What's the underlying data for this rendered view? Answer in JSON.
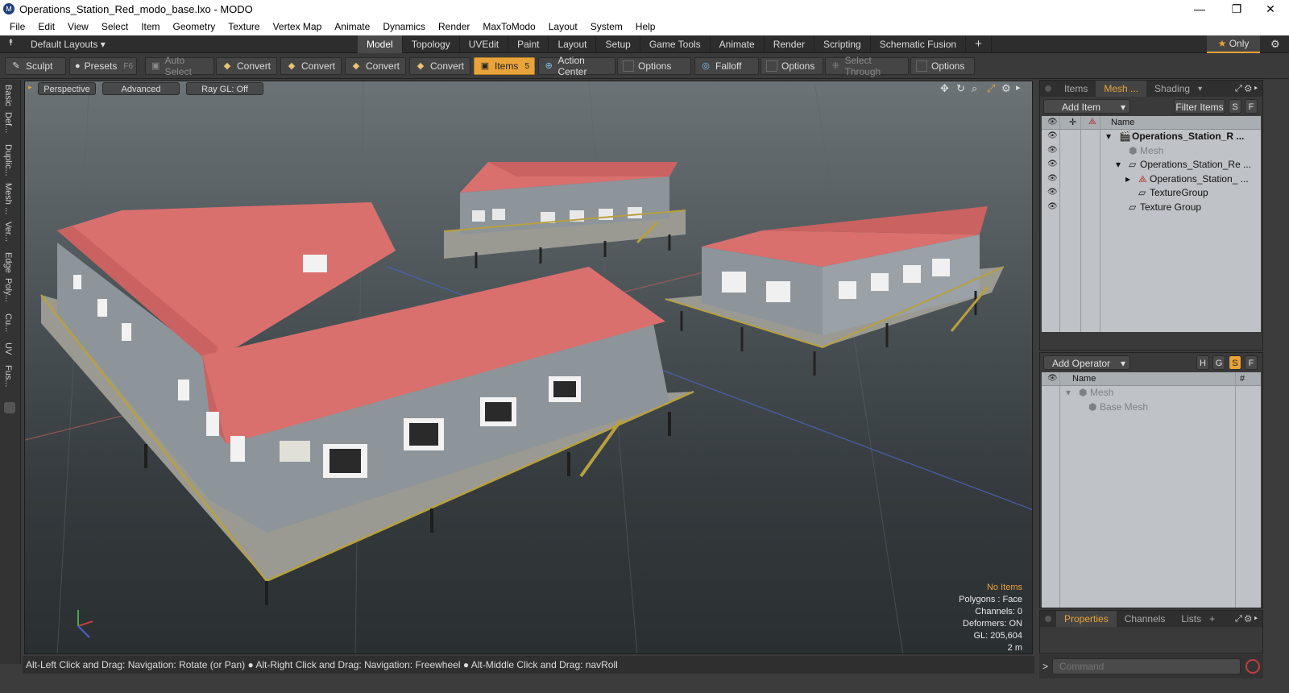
{
  "window": {
    "title": "Operations_Station_Red_modo_base.lxo - MODO",
    "app_icon": "modo-icon",
    "controls": [
      "—",
      "❐",
      "✕"
    ]
  },
  "menu": [
    "File",
    "Edit",
    "View",
    "Select",
    "Item",
    "Geometry",
    "Texture",
    "Vertex Map",
    "Animate",
    "Dynamics",
    "Render",
    "MaxToModo",
    "Layout",
    "System",
    "Help"
  ],
  "layout_bar": {
    "layouts_label": "Default Layouts ▾",
    "tabs": [
      "Model",
      "Topology",
      "UVEdit",
      "Paint",
      "Layout",
      "Setup",
      "Game Tools",
      "Animate",
      "Render",
      "Scripting",
      "Schematic Fusion"
    ],
    "active_tab": "Model",
    "add_tab": "+",
    "only_label": "Only"
  },
  "toolbar": {
    "sculpt": "Sculpt",
    "presets": "Presets",
    "presets_key": "F6",
    "auto_select": "Auto Select",
    "convert1": "Convert",
    "convert2": "Convert",
    "convert3": "Convert",
    "convert4": "Convert",
    "items": "Items",
    "items_key": "5",
    "action_center": "Action Center",
    "options1": "Options",
    "falloff": "Falloff",
    "options2": "Options",
    "select_through": "Select Through",
    "options3": "Options"
  },
  "left_strip": [
    "Basic",
    "Def...",
    "Duplic...",
    "Mesh ...",
    "Ver...",
    "Edge",
    "Poly...",
    "Cu...",
    "UV",
    "Fus..."
  ],
  "viewport": {
    "buttons": {
      "perspective": "Perspective",
      "advanced": "Advanced",
      "raygl": "Ray GL: Off"
    },
    "hud": {
      "selection": "No Items",
      "polygons": "Polygons : Face",
      "channels": "Channels: 0",
      "deformers": "Deformers: ON",
      "gl": "GL: 205,604",
      "scale": "2 m"
    }
  },
  "status_bar": "Alt-Left Click and Drag: Navigation: Rotate (or Pan) ● Alt-Right Click and Drag: Navigation: Freewheel ● Alt-Middle Click and Drag: navRoll",
  "items_panel": {
    "tabs": [
      "Items",
      "Mesh ...",
      "Shading"
    ],
    "active_tab": "Mesh ...",
    "add_item": "Add Item",
    "filter_items": "Filter Items",
    "s": "S",
    "f": "F",
    "col_name": "Name",
    "rows": [
      {
        "label": "Operations_Station_R ...",
        "bold": true
      },
      {
        "label": "Mesh",
        "dim": true
      },
      {
        "label": "Operations_Station_Re ..."
      },
      {
        "label": "Operations_Station_ ..."
      },
      {
        "label": "TextureGroup"
      },
      {
        "label": "Texture Group"
      }
    ]
  },
  "operator_panel": {
    "add_operator": "Add Operator",
    "h": "H",
    "g": "G",
    "s": "S",
    "f": "F",
    "col_name": "Name",
    "col_hash": "#",
    "rows": [
      {
        "label": "Mesh"
      },
      {
        "label": "Base Mesh"
      }
    ]
  },
  "properties_panel": {
    "tabs": [
      "Properties",
      "Channels",
      "Lists"
    ],
    "active_tab": "Properties",
    "add": "+"
  },
  "command": {
    "prompt": ">",
    "placeholder": "Command"
  },
  "colors": {
    "accent": "#e8a33a",
    "roof": "#d9706e",
    "wall": "#8d949a",
    "deck": "#9a9a92",
    "rail": "#b8a040"
  }
}
